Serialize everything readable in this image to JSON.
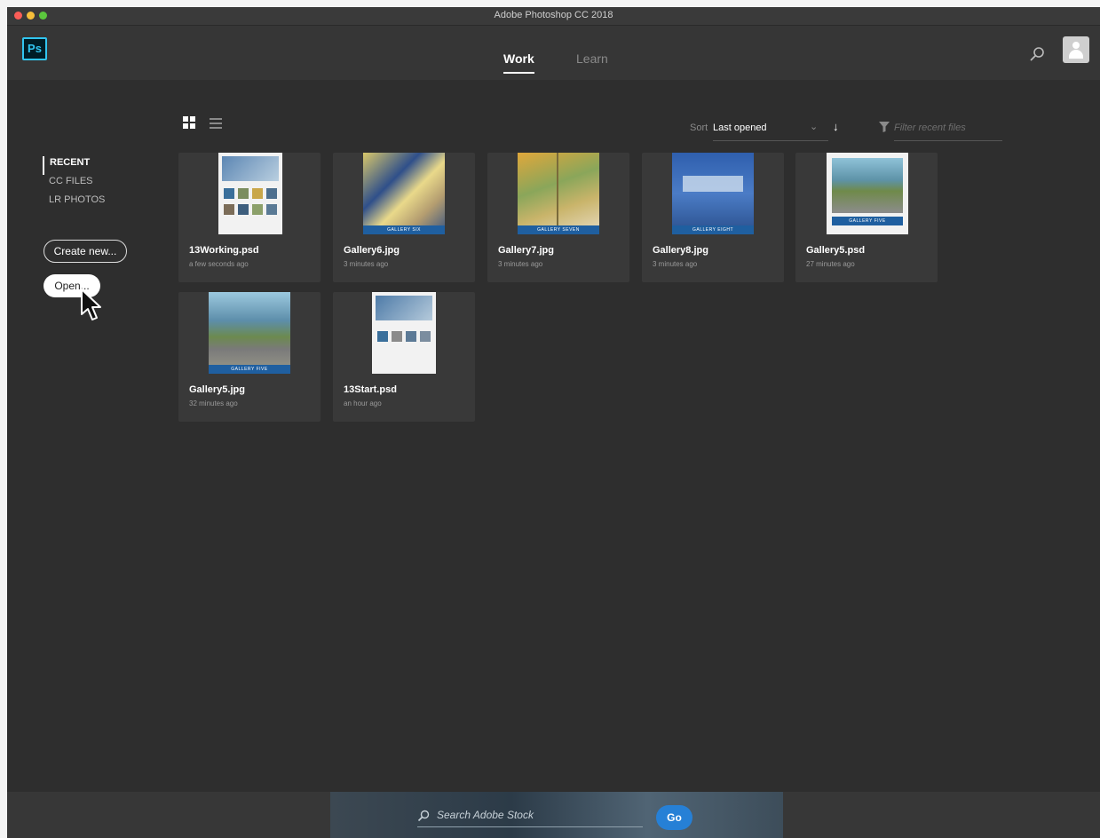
{
  "window": {
    "title": "Adobe Photoshop CC 2018"
  },
  "appbar": {
    "logo": "Ps",
    "tabs": [
      {
        "label": "Work",
        "active": true
      },
      {
        "label": "Learn",
        "active": false
      }
    ],
    "search_icon": "search-icon",
    "avatar_icon": "user-avatar-icon"
  },
  "sidebar": {
    "items": [
      {
        "label": "RECENT",
        "active": true
      },
      {
        "label": "CC FILES",
        "active": false
      },
      {
        "label": "LR PHOTOS",
        "active": false
      }
    ],
    "create_label": "Create new...",
    "open_label": "Open..."
  },
  "toolbar": {
    "sort_label": "Sort",
    "sort_value": "Last opened",
    "filter_placeholder": "Filter recent files"
  },
  "files": [
    {
      "name": "13Working.psd",
      "time": "a few seconds ago"
    },
    {
      "name": "Gallery6.jpg",
      "time": "3 minutes ago",
      "banner": "GALLERY SIX"
    },
    {
      "name": "Gallery7.jpg",
      "time": "3 minutes ago",
      "banner": "GALLERY SEVEN"
    },
    {
      "name": "Gallery8.jpg",
      "time": "3 minutes ago",
      "banner": "GALLERY EIGHT"
    },
    {
      "name": "Gallery5.psd",
      "time": "27 minutes ago",
      "banner": "GALLERY FIVE"
    },
    {
      "name": "Gallery5.jpg",
      "time": "32 minutes ago",
      "banner": "GALLERY FIVE"
    },
    {
      "name": "13Start.psd",
      "time": "an hour ago"
    }
  ],
  "stock": {
    "placeholder": "Search Adobe Stock",
    "go_label": "Go"
  },
  "colors": {
    "background": "#2e2e2e",
    "accent": "#2680d6",
    "ps_blue": "#31c5f0"
  }
}
